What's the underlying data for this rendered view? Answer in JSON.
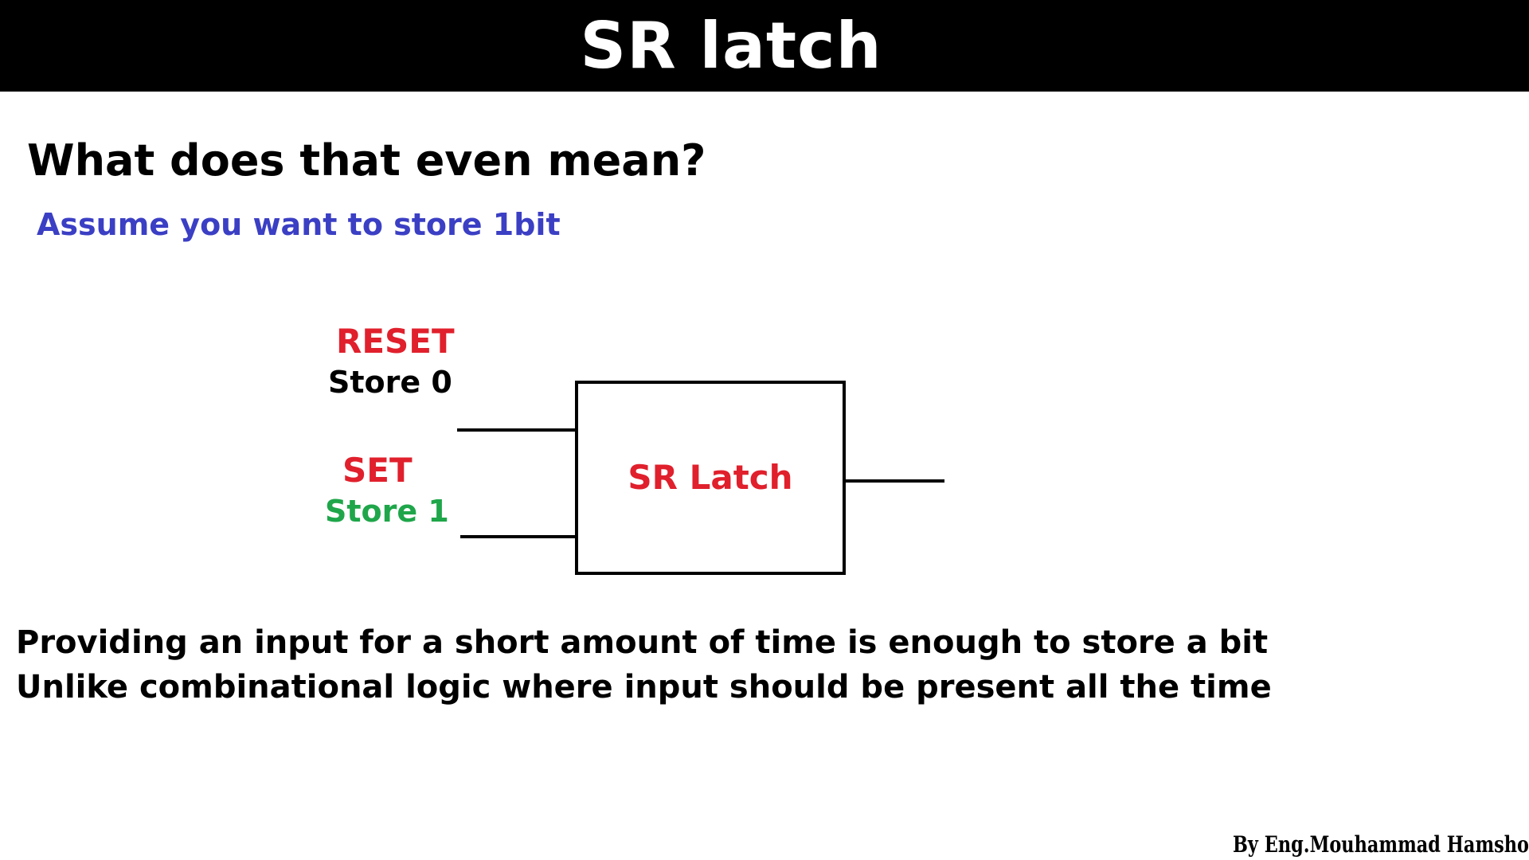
{
  "header": {
    "title": "SR latch"
  },
  "content": {
    "heading": "What does that even mean?",
    "subheading": "Assume you want to store 1bit"
  },
  "diagram": {
    "reset_label": "RESET",
    "reset_caption": "Store 0",
    "set_label": "SET",
    "set_caption": "Store 1",
    "block_label": "SR Latch"
  },
  "explanation": {
    "line1": "Providing an input for a short amount  of time is enough to store a bit",
    "line2": "Unlike combinational logic where input should be present all the time"
  },
  "footer": {
    "credit": "By Eng.Mouhammad Hamsho"
  },
  "colors": {
    "title_bar": "#000000",
    "subheading": "#3b3fc4",
    "red_label": "#e0202c",
    "green_label": "#1fa64a"
  }
}
